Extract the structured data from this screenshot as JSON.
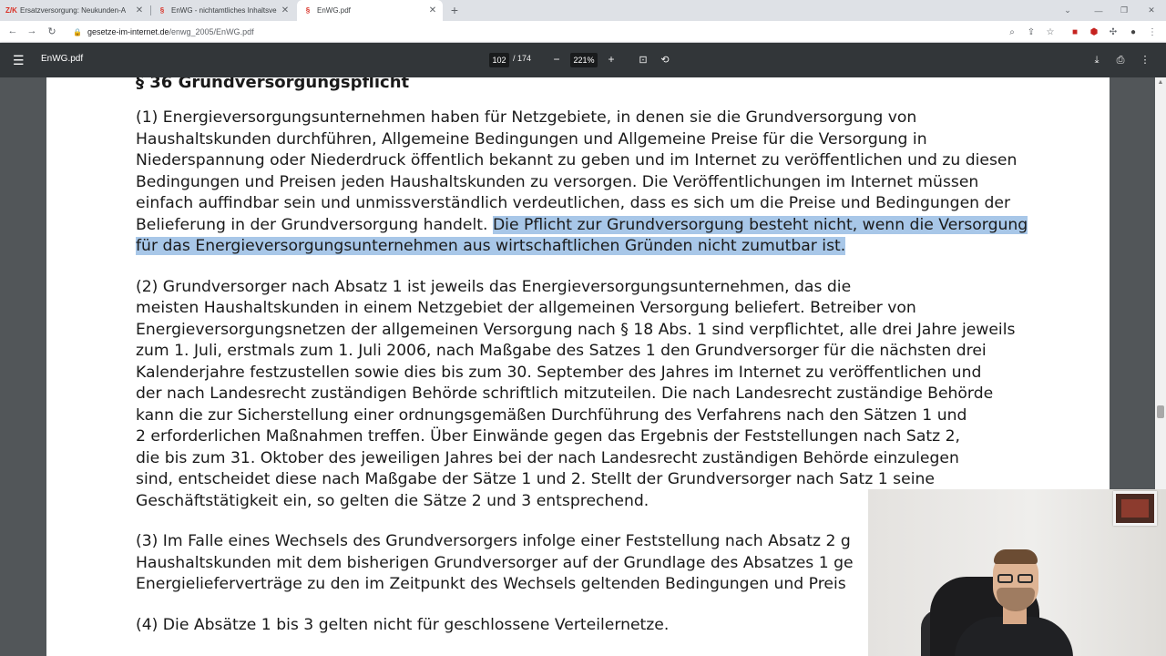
{
  "browser": {
    "tabs": [
      {
        "favicon": "Z/K",
        "title": "Ersatzversorgung: Neukunden-A",
        "active": false
      },
      {
        "favicon": "§",
        "title": "EnWG - nichtamtliches Inhaltsve",
        "active": false
      },
      {
        "favicon": "§",
        "title": "EnWG.pdf",
        "active": true
      }
    ],
    "new_tab": "+",
    "url_host": "gesetze-im-internet.de",
    "url_path": "/enwg_2005/EnWG.pdf"
  },
  "pdf_viewer": {
    "file_name": "EnWG.pdf",
    "current_page": "102",
    "total_pages": "/ 174",
    "zoom": "221%"
  },
  "document": {
    "heading": "§ 36 Grundversorgungspflicht",
    "paragraphs": [
      {
        "lines": [
          "(1) Energieversorgungsunternehmen haben für Netzgebiete, in denen sie die Grundversorgung von",
          "Haushaltskunden durchführen, Allgemeine Bedingungen und Allgemeine Preise für die Versorgung in",
          "Niederspannung oder Niederdruck öffentlich bekannt zu geben und im Internet zu veröffentlichen und zu diesen",
          "Bedingungen und Preisen jeden Haushaltskunden zu versorgen. Die Veröffentlichungen im Internet müssen",
          "einfach auffindbar sein und unmissverständlich verdeutlichen, dass es sich um die Preise und Bedingungen der"
        ],
        "line6_plain": "Belieferung in der Grundversorgung handelt. ",
        "line6_highlight": "Die Pflicht zur Grundversorgung besteht nicht, wenn die Versorgung",
        "line7_highlight": "für das Energieversorgungsunternehmen aus wirtschaftlichen Gründen nicht zumutbar ist."
      },
      {
        "lines": [
          "(2) Grundversorger nach Absatz 1 ist jeweils das Energieversorgungsunternehmen, das die",
          "meisten Haushaltskunden in einem Netzgebiet der allgemeinen Versorgung beliefert. Betreiber von",
          "Energieversorgungsnetzen der allgemeinen Versorgung nach § 18 Abs. 1 sind verpflichtet, alle drei Jahre jeweils",
          "zum 1. Juli, erstmals zum 1. Juli 2006, nach Maßgabe des Satzes 1 den Grundversorger für die nächsten drei",
          "Kalenderjahre festzustellen sowie dies bis zum 30. September des Jahres im Internet zu veröffentlichen und",
          "der nach Landesrecht zuständigen Behörde schriftlich mitzuteilen. Die nach Landesrecht zuständige Behörde",
          "kann die zur Sicherstellung einer ordnungsgemäßen Durchführung des Verfahrens nach den Sätzen 1 und",
          "2 erforderlichen Maßnahmen treffen. Über Einwände gegen das Ergebnis der Feststellungen nach Satz 2,",
          "die bis zum 31. Oktober des jeweiligen Jahres bei der nach Landesrecht zuständigen Behörde einzulegen",
          "sind, entscheidet diese nach Maßgabe der Sätze 1 und 2. Stellt der Grundversorger nach Satz 1 seine",
          "Geschäftstätigkeit ein, so gelten die Sätze 2 und 3 entsprechend."
        ]
      },
      {
        "lines": [
          "(3) Im Falle eines Wechsels des Grundversorgers infolge einer Feststellung nach Absatz 2 g",
          "Haushaltskunden mit dem bisherigen Grundversorger auf der Grundlage des Absatzes 1 ge",
          "Energielieferverträge zu den im Zeitpunkt des Wechsels geltenden Bedingungen und Preis"
        ]
      },
      {
        "lines": [
          "(4) Die Absätze 1 bis 3 gelten nicht für geschlossene Verteilernetze."
        ]
      }
    ]
  },
  "colors": {
    "pdf_toolbar": "#323639",
    "highlight": "#a8c7e8",
    "viewer_background": "#525659"
  }
}
